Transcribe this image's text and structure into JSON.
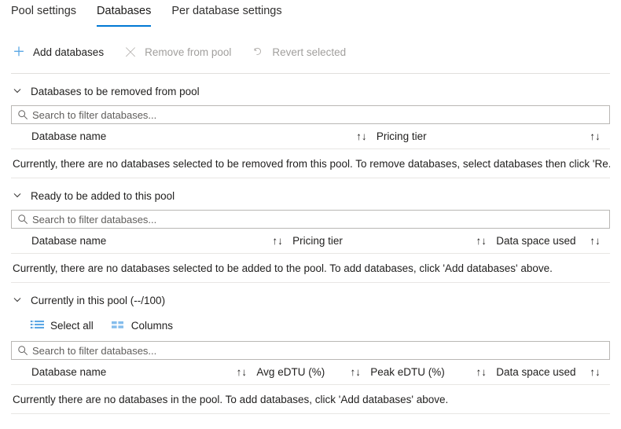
{
  "tabs": [
    {
      "label": "Pool settings",
      "active": false
    },
    {
      "label": "Databases",
      "active": true
    },
    {
      "label": "Per database settings",
      "active": false
    }
  ],
  "toolbar": {
    "add_databases": "Add databases",
    "remove_from_pool": "Remove from pool",
    "revert_selected": "Revert selected"
  },
  "search": {
    "placeholder": "Search to filter databases...",
    "value": ""
  },
  "sort_glyph": "↑↓",
  "colors": {
    "accent": "#0078d4",
    "icon_blue": "#5ba7e5",
    "disabled": "#a19f9d",
    "divider": "#e8e6e4"
  },
  "sections": [
    {
      "title": "Databases to be removed from pool",
      "columns": [
        "Database name",
        "Pricing tier"
      ],
      "empty_message": "Currently, there are no databases selected to be removed from this pool. To remove databases, select databases then click 'Re..."
    },
    {
      "title": "Ready to be added to this pool",
      "columns": [
        "Database name",
        "Pricing tier",
        "Data space used"
      ],
      "empty_message": "Currently, there are no databases selected to be added to the pool. To add databases, click 'Add databases' above."
    },
    {
      "title": "Currently in this pool (--/100)",
      "subcommands": {
        "select_all": "Select all",
        "columns": "Columns"
      },
      "columns": [
        "Database name",
        "Avg eDTU (%)",
        "Peak eDTU (%)",
        "Data space used"
      ],
      "empty_message": "Currently there are no databases in the pool. To add databases, click 'Add databases' above."
    }
  ]
}
